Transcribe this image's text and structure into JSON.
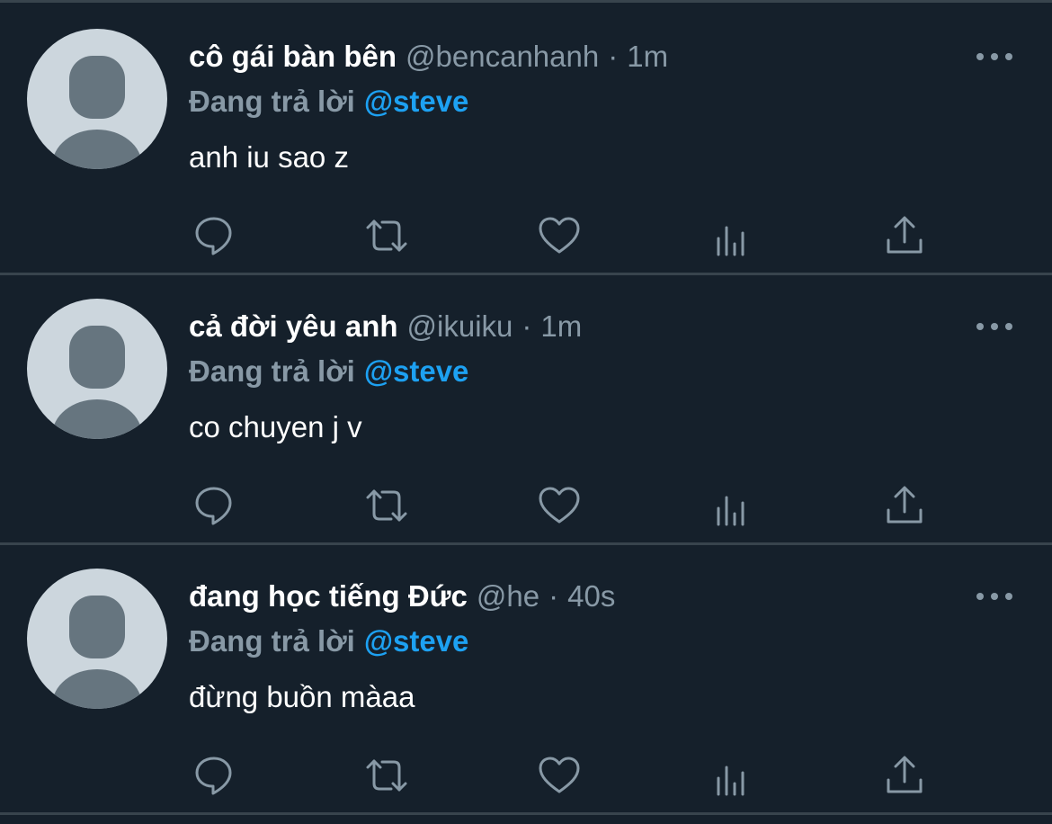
{
  "feed": {
    "tweets": [
      {
        "display_name": "cô gái bàn bên",
        "handle": "@bencanhanh",
        "separator": "·",
        "time": "1m",
        "reply_prefix": "Đang trả lời",
        "reply_to": "@steve",
        "text": "anh iu sao z"
      },
      {
        "display_name": "cả đời yêu anh",
        "handle": "@ikuiku",
        "separator": "·",
        "time": "1m",
        "reply_prefix": "Đang trả lời",
        "reply_to": "@steve",
        "text": "co chuyen j v"
      },
      {
        "display_name": "đang học tiếng Đức",
        "handle": "@he",
        "separator": "·",
        "time": "40s",
        "reply_prefix": "Đang trả lời",
        "reply_to": "@steve",
        "text": "đừng buồn màaa"
      }
    ]
  },
  "icons": {
    "reply": "reply-icon",
    "retweet": "retweet-icon",
    "like": "heart-icon",
    "analytics": "analytics-icon",
    "share": "share-icon",
    "more": "more-icon"
  },
  "colors": {
    "background": "#15202b",
    "divider": "#38444d",
    "muted": "#8899a6",
    "accent": "#1da1f2",
    "avatar_bg": "#ccd6dd",
    "avatar_fg": "#66757f"
  }
}
